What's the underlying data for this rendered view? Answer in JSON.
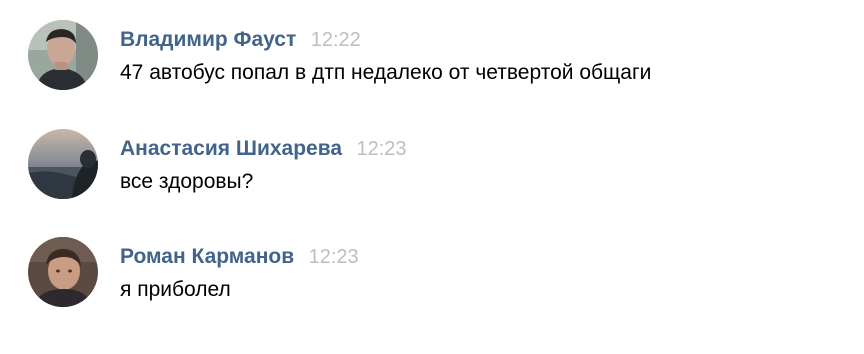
{
  "messages": [
    {
      "author": "Владимир Фауст",
      "time": "12:22",
      "text": "47 автобус попал в дтп недалеко от четвертой общаги"
    },
    {
      "author": "Анастасия Шихарева",
      "time": "12:23",
      "text": "все здоровы?"
    },
    {
      "author": "Роман Карманов",
      "time": "12:23",
      "text": "я приболел"
    }
  ],
  "colors": {
    "author": "#42648b",
    "time": "#b9bfc6",
    "text": "#000000",
    "background": "#ffffff"
  }
}
